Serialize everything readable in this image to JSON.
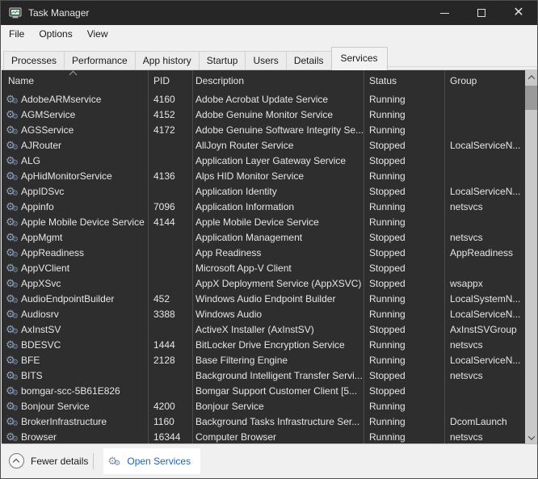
{
  "window": {
    "title": "Task Manager",
    "controls": {
      "minimize": "minimize",
      "maximize": "maximize",
      "close": "✕"
    }
  },
  "menu": {
    "items": [
      "File",
      "Options",
      "View"
    ]
  },
  "tabs": {
    "items": [
      "Processes",
      "Performance",
      "App history",
      "Startup",
      "Users",
      "Details",
      "Services"
    ],
    "active": "Services"
  },
  "table": {
    "columns": [
      "Name",
      "PID",
      "Description",
      "Status",
      "Group"
    ],
    "sort": {
      "column": "Name",
      "direction": "ascending"
    },
    "rows": [
      {
        "name": "AdobeARMservice",
        "pid": "4160",
        "description": "Adobe Acrobat Update Service",
        "status": "Running",
        "group": ""
      },
      {
        "name": "AGMService",
        "pid": "4152",
        "description": "Adobe Genuine Monitor Service",
        "status": "Running",
        "group": ""
      },
      {
        "name": "AGSService",
        "pid": "4172",
        "description": "Adobe Genuine Software Integrity Se...",
        "status": "Running",
        "group": ""
      },
      {
        "name": "AJRouter",
        "pid": "",
        "description": "AllJoyn Router Service",
        "status": "Stopped",
        "group": "LocalServiceN..."
      },
      {
        "name": "ALG",
        "pid": "",
        "description": "Application Layer Gateway Service",
        "status": "Stopped",
        "group": ""
      },
      {
        "name": "ApHidMonitorService",
        "pid": "4136",
        "description": "Alps HID Monitor Service",
        "status": "Running",
        "group": ""
      },
      {
        "name": "AppIDSvc",
        "pid": "",
        "description": "Application Identity",
        "status": "Stopped",
        "group": "LocalServiceN..."
      },
      {
        "name": "Appinfo",
        "pid": "7096",
        "description": "Application Information",
        "status": "Running",
        "group": "netsvcs"
      },
      {
        "name": "Apple Mobile Device Service",
        "pid": "4144",
        "description": "Apple Mobile Device Service",
        "status": "Running",
        "group": ""
      },
      {
        "name": "AppMgmt",
        "pid": "",
        "description": "Application Management",
        "status": "Stopped",
        "group": "netsvcs"
      },
      {
        "name": "AppReadiness",
        "pid": "",
        "description": "App Readiness",
        "status": "Stopped",
        "group": "AppReadiness"
      },
      {
        "name": "AppVClient",
        "pid": "",
        "description": "Microsoft App-V Client",
        "status": "Stopped",
        "group": ""
      },
      {
        "name": "AppXSvc",
        "pid": "",
        "description": "AppX Deployment Service (AppXSVC)",
        "status": "Stopped",
        "group": "wsappx"
      },
      {
        "name": "AudioEndpointBuilder",
        "pid": "452",
        "description": "Windows Audio Endpoint Builder",
        "status": "Running",
        "group": "LocalSystemN..."
      },
      {
        "name": "Audiosrv",
        "pid": "3388",
        "description": "Windows Audio",
        "status": "Running",
        "group": "LocalServiceN..."
      },
      {
        "name": "AxInstSV",
        "pid": "",
        "description": "ActiveX Installer (AxInstSV)",
        "status": "Stopped",
        "group": "AxInstSVGroup"
      },
      {
        "name": "BDESVC",
        "pid": "1444",
        "description": "BitLocker Drive Encryption Service",
        "status": "Running",
        "group": "netsvcs"
      },
      {
        "name": "BFE",
        "pid": "2128",
        "description": "Base Filtering Engine",
        "status": "Running",
        "group": "LocalServiceN..."
      },
      {
        "name": "BITS",
        "pid": "",
        "description": "Background Intelligent Transfer Servi...",
        "status": "Stopped",
        "group": "netsvcs"
      },
      {
        "name": "bomgar-scc-5B61E826",
        "pid": "",
        "description": "Bomgar Support Customer Client [5...",
        "status": "Stopped",
        "group": ""
      },
      {
        "name": "Bonjour Service",
        "pid": "4200",
        "description": "Bonjour Service",
        "status": "Running",
        "group": ""
      },
      {
        "name": "BrokerInfrastructure",
        "pid": "1160",
        "description": "Background Tasks Infrastructure Ser...",
        "status": "Running",
        "group": "DcomLaunch"
      },
      {
        "name": "Browser",
        "pid": "16344",
        "description": "Computer Browser",
        "status": "Running",
        "group": "netsvcs"
      }
    ]
  },
  "statusbar": {
    "fewer_details_label": "Fewer details",
    "open_services_label": "Open Services"
  },
  "icons": {
    "app": "task-manager-icon",
    "service_row": "service-gear-icon",
    "fewer_details": "chevron-up-circle-icon",
    "open_services": "service-gear-icon",
    "sort": "sort-ascending-caret-icon"
  },
  "colors": {
    "titlebar_bg": "#262626",
    "titlebar_text": "#e8e8e8",
    "chrome_bg": "#f0f0f0",
    "list_bg": "#2e2e2e",
    "list_text": "#e6e6e6",
    "column_separator": "#4b4b4b",
    "scrollbar_track": "#c9c9c9",
    "scrollbar_thumb": "#9a9a9a",
    "link_blue": "#2064ae",
    "highlight_white": "#ffffff",
    "gear_icon": "#8ea3bd"
  }
}
